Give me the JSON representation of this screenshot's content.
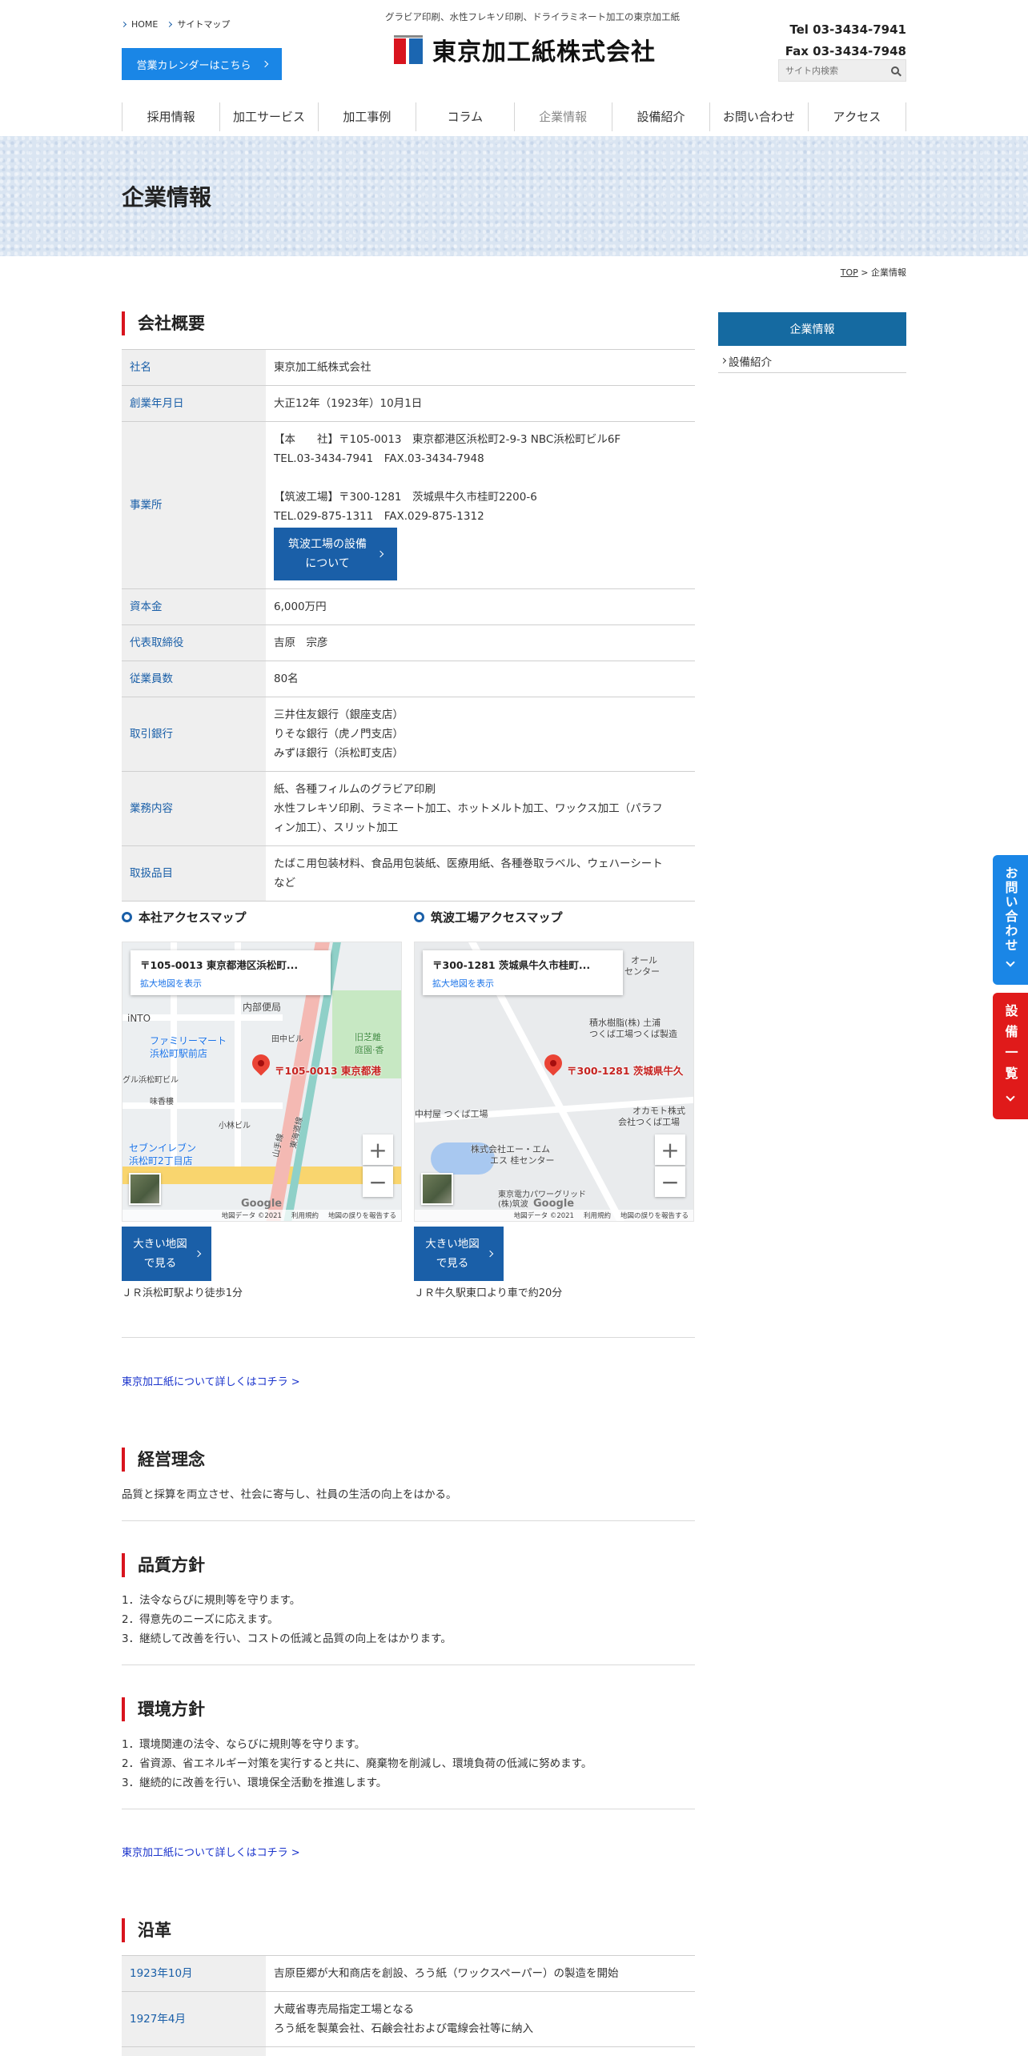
{
  "header": {
    "toplinks": [
      "HOME",
      "サイトマップ"
    ],
    "calendar_button": "営業カレンダーはこちら",
    "tagline": "グラビア印刷、水性フレキソ印刷、ドライラミネート加工の東京加工紙",
    "logo_text": "東京加工紙株式会社",
    "tel": "Tel 03-3434-7941",
    "fax": "Fax 03-3434-7948",
    "search_placeholder": "サイト内検索"
  },
  "nav": [
    "採用情報",
    "加工サービス",
    "加工事例",
    "コラム",
    "企業情報",
    "設備紹介",
    "お問い合わせ",
    "アクセス"
  ],
  "hero": {
    "title": "企業情報"
  },
  "breadcrumb": {
    "top": "TOP",
    "sep": " > ",
    "current": "企業情報"
  },
  "sidebar": {
    "head": "企業情報",
    "items": [
      "設備紹介"
    ]
  },
  "overview": {
    "heading": "会社概要",
    "rows": {
      "name": {
        "label": "社名",
        "value": "東京加工紙株式会社"
      },
      "founded": {
        "label": "創業年月日",
        "value": "大正12年（1923年）10月1日"
      },
      "office": {
        "label": "事業所",
        "lines": [
          "【本　　社】〒105-0013　東京都港区浜松町2-9-3 NBC浜松町ビル6F",
          "TEL.03-3434-7941　FAX.03-3434-7948",
          "【筑波工場】〒300-1281　茨城県牛久市桂町2200-6",
          "TEL.029-875-1311　FAX.029-875-1312"
        ],
        "button": [
          "筑波工場の設備",
          "について"
        ]
      },
      "capital": {
        "label": "資本金",
        "value": "6,000万円"
      },
      "ceo": {
        "label": "代表取締役",
        "value": "吉原　宗彦"
      },
      "employees": {
        "label": "従業員数",
        "value": "80名"
      },
      "banks": {
        "label": "取引銀行",
        "lines": [
          "三井住友銀行（銀座支店）",
          "りそな銀行（虎ノ門支店）",
          "みずほ銀行（浜松町支店）"
        ]
      },
      "business": {
        "label": "業務内容",
        "lines": [
          "紙、各種フィルムのグラビア印刷",
          "水性フレキソ印刷、ラミネート加工、ホットメルト加工、ワックス加工（パラフ",
          "ィン加工）、スリット加工"
        ]
      },
      "products": {
        "label": "取扱品目",
        "lines": [
          "たばこ用包装材料、食品用包装紙、医療用紙、各種巻取ラベル、ウェハーシート",
          "など"
        ]
      }
    }
  },
  "maps": [
    {
      "title": "本社アクセスマップ",
      "card_title": "〒105-0013 東京都港区浜松町...",
      "card_link": "拡大地図を表示",
      "pin_label": "〒105-0013 東京都港",
      "pois": [
        "内部便局",
        "iNTO",
        "ファミリーマート",
        "浜松町駅前店",
        "田中ビル",
        "旧芝離",
        "庭園·香",
        "グル浜松町ビル",
        "味香樓",
        "小林ビル",
        "セブンイレブン",
        "浜松町2丁目店",
        "山手線",
        "東海道線"
      ],
      "footer": [
        "地図データ ©2021",
        "利用規約",
        "地図の誤りを報告する"
      ],
      "google": "Google",
      "button": [
        "大きい地図",
        "で見る"
      ],
      "note": "ＪＲ浜松町駅より徒歩1分"
    },
    {
      "title": "筑波工場アクセスマップ",
      "card_title": "〒300-1281 茨城県牛久市桂町...",
      "card_link": "拡大地図を表示",
      "pin_label": "〒300-1281 茨城県牛久",
      "pois": [
        "積水樹脂(株) 土浦",
        "つくば工場つくば製造",
        "中村屋 つくば工場",
        "株式会社エー・エム",
        "エス 桂センター",
        "オカモト株式",
        "会社つくば工場",
        "東京電力パワーグリッド",
        "(株)筑波",
        "オール",
        "センター"
      ],
      "footer": [
        "地図データ ©2021",
        "利用規約",
        "地図の誤りを報告する"
      ],
      "google": "Google",
      "button": [
        "大きい地図",
        "で見る"
      ],
      "note": "ＪＲ牛久駅東口より車で約20分"
    }
  ],
  "more_link": "東京加工紙について詳しくはコチラ >",
  "philosophy": {
    "heading": "経営理念",
    "text": "品質と採算を両立させ、社会に寄与し、社員の生活の向上をはかる。"
  },
  "quality": {
    "heading": "品質方針",
    "lines": [
      "1．法令ならびに規則等を守ります。",
      "2．得意先のニーズに応えます。",
      "3．継続して改善を行い、コストの低減と品質の向上をはかります。"
    ]
  },
  "environment": {
    "heading": "環境方針",
    "lines": [
      "1．環境関連の法令、ならびに規則等を守ります。",
      "2．省資源、省エネルギー対策を実行すると共に、廃棄物を削減し、環境負荷の低減に努めます。",
      "3．継続的に改善を行い、環境保全活動を推進します。"
    ]
  },
  "history": {
    "heading": "沿革",
    "rows": [
      {
        "date": "1923年10月",
        "lines": [
          "吉原臣郷が大和商店を創設、ろう紙（ワックスペーパー）の製造を開始"
        ]
      },
      {
        "date": "1927年4月",
        "lines": [
          "大蔵省専売局指定工場となる",
          "ろう紙を製菓会社、石鹸会社および電線会社等に納入"
        ]
      }
    ]
  },
  "float_tabs": {
    "contact": "お問い合わせ",
    "equipment": "設備一覧",
    "contact_color": "#1a86e6",
    "equipment_color": "#e01a1a"
  },
  "colors": {
    "primary": "#1a5fa8",
    "accent_red": "#d8141e",
    "side_head": "#156aa1"
  }
}
